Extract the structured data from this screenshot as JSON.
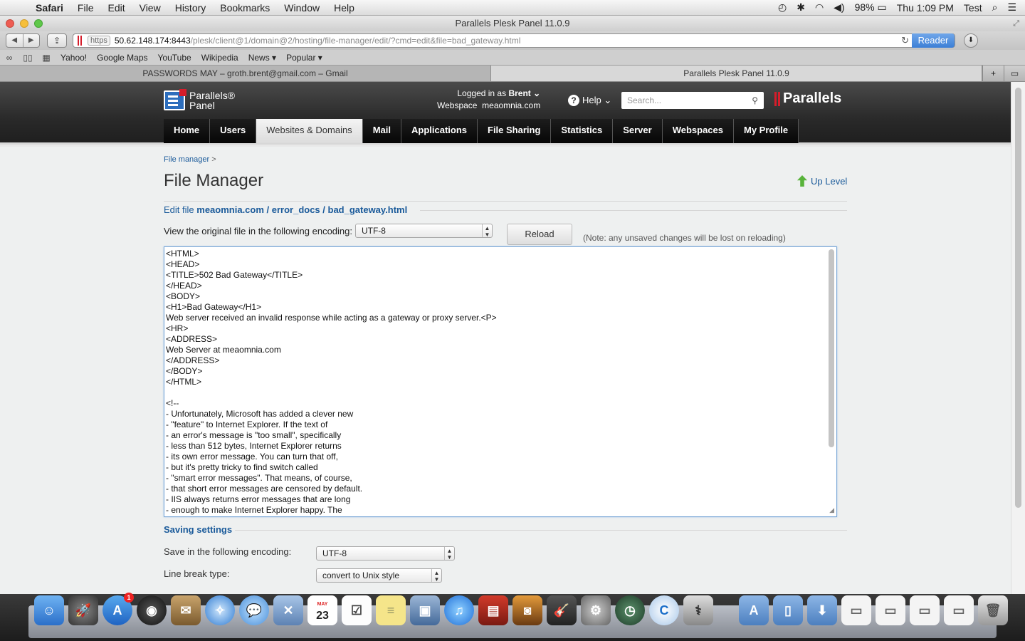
{
  "menubar": {
    "app": "Safari",
    "items": [
      "File",
      "Edit",
      "View",
      "History",
      "Bookmarks",
      "Window",
      "Help"
    ],
    "battery": "98%",
    "clock": "Thu 1:09 PM",
    "user": "Test"
  },
  "window": {
    "title": "Parallels Plesk Panel 11.0.9"
  },
  "toolbar": {
    "scheme": "https",
    "host": "50.62.148.174:8443",
    "path": "/plesk/client@1/domain@2/hosting/file-manager/edit/?cmd=edit&file=bad_gateway.html",
    "reader": "Reader"
  },
  "bookmarks": [
    "Yahoo!",
    "Google Maps",
    "YouTube",
    "Wikipedia",
    "News ▾",
    "Popular ▾"
  ],
  "tabs": [
    "PASSWORDS MAY – groth.brent@gmail.com – Gmail",
    "Parallels Plesk Panel 11.0.9"
  ],
  "plesk": {
    "logo_line1": "Parallels®",
    "logo_line2": "Panel",
    "logged_in_label": "Logged in as",
    "user": "Brent ⌄",
    "webspace_label": "Webspace",
    "webspace": "meaomnia.com",
    "help": "Help ⌄",
    "search_placeholder": "Search...",
    "brand": "Parallels",
    "nav": [
      "Home",
      "Users",
      "Websites & Domains",
      "Mail",
      "Applications",
      "File Sharing",
      "Statistics",
      "Server",
      "Webspaces",
      "My Profile"
    ]
  },
  "page": {
    "breadcrumb": "File manager",
    "breadcrumb_sep": ">",
    "title": "File Manager",
    "up_level": "Up Level",
    "edit_file_prefix": "Edit file",
    "edit_file_path": "meaomnia.com / error_docs / bad_gateway.html",
    "encoding_label": "View the original file in the following encoding:",
    "encoding_value": "UTF-8",
    "reload": "Reload",
    "note": "(Note: any unsaved changes will be lost on reloading)",
    "file_content": "<HTML>\n<HEAD>\n<TITLE>502 Bad Gateway</TITLE>\n</HEAD>\n<BODY>\n<H1>Bad Gateway</H1>\nWeb server received an invalid response while acting as a gateway or proxy server.<P>\n<HR>\n<ADDRESS>\nWeb Server at meaomnia.com\n</ADDRESS>\n</BODY>\n</HTML>\n\n<!--\n- Unfortunately, Microsoft has added a clever new\n- \"feature\" to Internet Explorer. If the text of\n- an error's message is \"too small\", specifically\n- less than 512 bytes, Internet Explorer returns\n- its own error message. You can turn that off,\n- but it's pretty tricky to find switch called\n- \"smart error messages\". That means, of course,\n- that short error messages are censored by default.\n- IIS always returns error messages that are long\n- enough to make Internet Explorer happy. The",
    "saving_settings": "Saving settings",
    "save_encoding_label": "Save in the following encoding:",
    "save_encoding_value": "UTF-8",
    "line_break_label": "Line break type:",
    "line_break_value": "convert to Unix style"
  },
  "dock": {
    "calendar_day": "23",
    "calendar_month": "MAY",
    "appstore_badge": "1"
  }
}
